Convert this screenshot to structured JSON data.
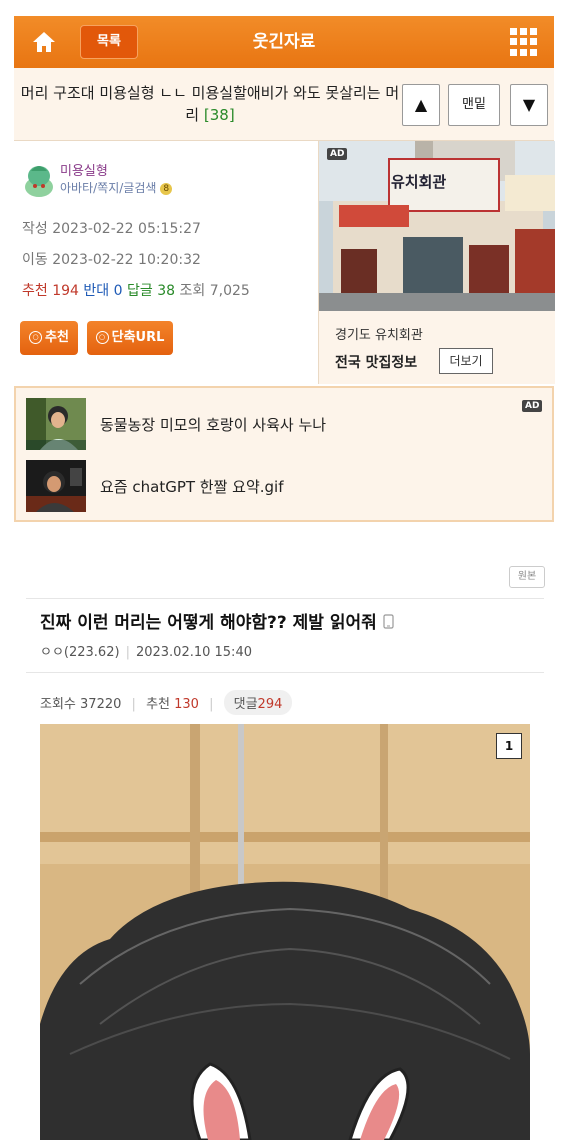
{
  "header": {
    "list_label": "목록",
    "board_title": "웃긴자료",
    "home_icon": "home-icon",
    "menu_icon": "grid-menu-icon",
    "accent_color": "#f07f1e"
  },
  "post": {
    "title": "머리 구조대 미용실형 ㄴㄴ 미용실할애비가 와도 못살리는 머리",
    "comment_count_label": "[38]",
    "up_label": "▲",
    "bottom_label": "맨밑",
    "down_label": "▼"
  },
  "author": {
    "name": "미용실형",
    "links": "아바타/쪽지/글검색",
    "level_badge": "8"
  },
  "meta": {
    "written_label": "작성",
    "written": "2023-02-22 05:15:27",
    "moved_label": "이동",
    "moved": "2023-02-22 10:20:32",
    "rec_label": "추천",
    "rec": "194",
    "opp_label": "반대",
    "opp": "0",
    "reply_label": "답글",
    "reply": "38",
    "view_label": "조회",
    "views": "7,025"
  },
  "buttons": {
    "recommend": "추천",
    "short_url": "단축URL"
  },
  "ad_right": {
    "ad_tag": "AD",
    "sign_text": "유치회관",
    "caption": "경기도 유치회관",
    "strong": "전국 맛집정보",
    "more": "더보기"
  },
  "related": {
    "ad_tag": "AD",
    "items": [
      {
        "text": "동물농장 미모의 호랑이 사육사 누나"
      },
      {
        "text": "요즘 chatGPT 한짤 요약.gif"
      }
    ]
  },
  "article": {
    "original_label": "원본",
    "title": "진짜 이런 머리는 어떻게 해야함?? 제발 읽어줘",
    "author": "ㅇㅇ(223.62)",
    "date": "2023.02.10 15:40",
    "views_label": "조회수",
    "views": "37220",
    "rec_label": "추천",
    "rec": "130",
    "cmt_label": "댓글",
    "cmt": "294",
    "image_number": "1"
  }
}
